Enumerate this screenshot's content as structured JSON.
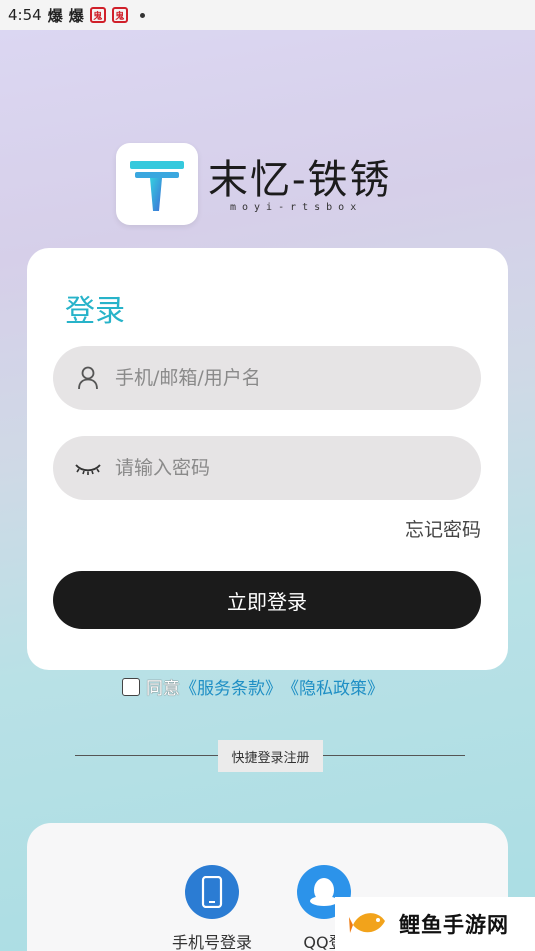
{
  "status_bar": {
    "time": "4:54",
    "notif1": "爆",
    "notif2": "爆",
    "badge1": "鬼",
    "badge2": "鬼"
  },
  "brand": {
    "name": "末忆-铁锈",
    "subtitle": "moyi-rtsbox",
    "logo_color": "#2bb5cf"
  },
  "login": {
    "title": "登录",
    "username_placeholder": "手机/邮箱/用户名",
    "password_placeholder": "请输入密码",
    "forgot_label": "忘记密码",
    "submit_label": "立即登录"
  },
  "agreement": {
    "prefix": "同意",
    "terms": "《服务条款》",
    "privacy": "《隐私政策》",
    "checked": false
  },
  "quick": {
    "label": "快捷登录注册",
    "options": [
      {
        "label": "手机号登录",
        "icon": "phone-icon",
        "color": "#2b7cd3"
      },
      {
        "label": "QQ登",
        "icon": "qq-icon",
        "color": "#2c93ea"
      }
    ]
  },
  "watermark": {
    "text": "鲤鱼手游网",
    "icon": "fish-logo-icon"
  },
  "colors": {
    "accent": "#27b3c9",
    "button": "#1b1b1b",
    "link": "#1f8fc5"
  }
}
